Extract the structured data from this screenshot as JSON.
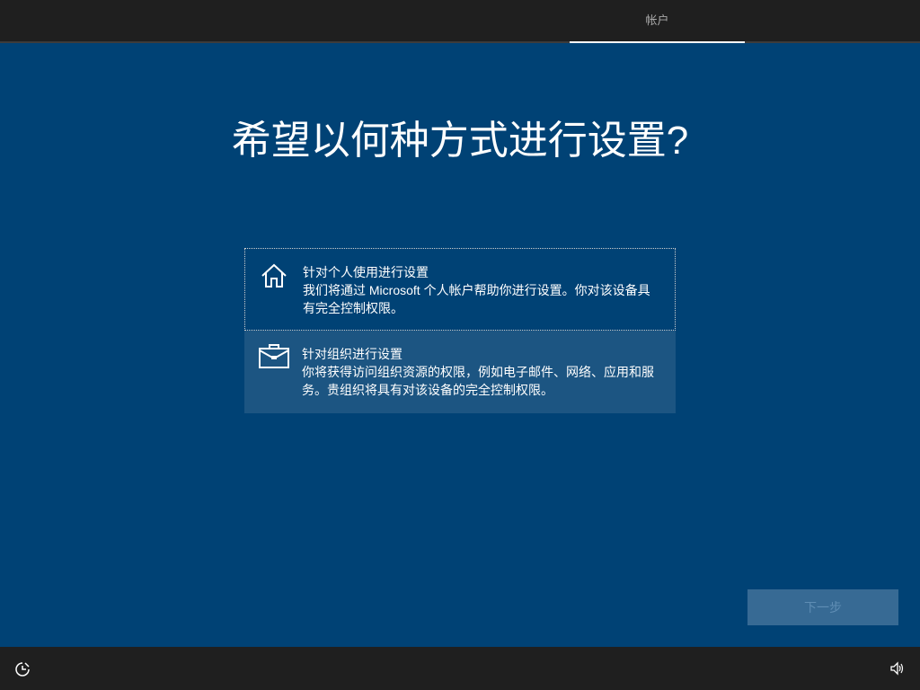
{
  "header": {
    "tab_label": "帐户"
  },
  "main": {
    "title": "希望以何种方式进行设置?",
    "options": [
      {
        "title": "针对个人使用进行设置",
        "description": "我们将通过 Microsoft 个人帐户帮助你进行设置。你对该设备具有完全控制权限。",
        "icon": "home-icon"
      },
      {
        "title": "针对组织进行设置",
        "description": "你将获得访问组织资源的权限，例如电子邮件、网络、应用和服务。贵组织将具有对该设备的完全控制权限。",
        "icon": "briefcase-icon"
      }
    ],
    "next_label": "下一步"
  },
  "footer": {
    "left_icon": "accessibility-icon",
    "right_icon": "volume-icon"
  }
}
